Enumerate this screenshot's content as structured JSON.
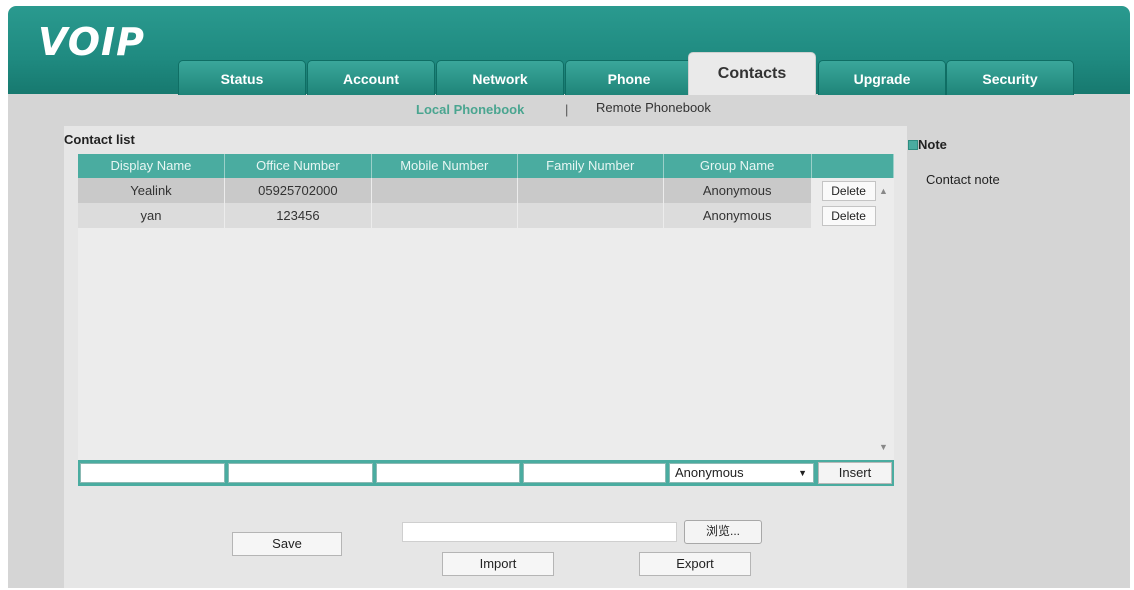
{
  "app": {
    "logo": "VOIP"
  },
  "tabs": [
    {
      "label": "Status"
    },
    {
      "label": "Account"
    },
    {
      "label": "Network"
    },
    {
      "label": "Phone"
    },
    {
      "label": "Contacts"
    },
    {
      "label": "Upgrade"
    },
    {
      "label": "Security"
    }
  ],
  "subnav": {
    "local": "Local Phonebook",
    "separator": "|",
    "remote": "Remote Phonebook"
  },
  "contacts": {
    "title": "Contact list",
    "columns": [
      "Display Name",
      "Office Number",
      "Mobile Number",
      "Family Number",
      "Group Name",
      ""
    ],
    "rows": [
      {
        "display_name": "Yealink",
        "office": "05925702000",
        "mobile": "",
        "family": "",
        "group": "Anonymous",
        "action": "Delete"
      },
      {
        "display_name": "yan",
        "office": "123456",
        "mobile": "",
        "family": "",
        "group": "Anonymous",
        "action": "Delete"
      }
    ],
    "new_entry": {
      "group_selected": "Anonymous",
      "insert_label": "Insert"
    }
  },
  "actions": {
    "save": "Save",
    "browse": "浏览...",
    "import": "Import",
    "export": "Export"
  },
  "note": {
    "title": "Note",
    "text": "Contact note"
  },
  "colors": {
    "header_teal": "#1f8a80",
    "grid_teal": "#4aaca0",
    "active_link": "#4aa590"
  }
}
